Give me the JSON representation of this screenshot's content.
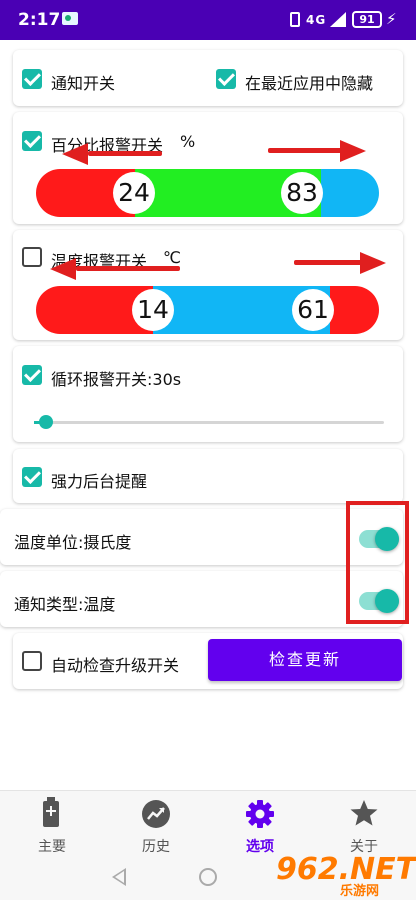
{
  "status_bar": {
    "time": "2:17",
    "network": "4G",
    "battery": "91",
    "bolt": "⚡"
  },
  "notify_card": {
    "notify_switch_label": "通知开关",
    "notify_switch_checked": true,
    "hide_recent_label": "在最近应用中隐藏",
    "hide_recent_checked": true
  },
  "percent_card": {
    "label": "百分比报警开关",
    "unit": "%",
    "checked": true,
    "low_value": "24",
    "high_value": "83",
    "colors": {
      "low": "#ff1a1a",
      "mid": "#22ee22",
      "high": "#11b6f5"
    }
  },
  "temp_card": {
    "label": "温度报警开关",
    "unit": "℃",
    "checked": false,
    "low_value": "14",
    "high_value": "61",
    "colors": {
      "low": "#ff1a1a",
      "mid": "#11b6f5",
      "high": "#ff1a1a"
    }
  },
  "loop_card": {
    "label": "循环报警开关:30s",
    "checked": true,
    "slider_level": 0.03
  },
  "force_card": {
    "label": "强力后台提醒",
    "checked": true
  },
  "temp_unit_row": {
    "label": "温度单位:摄氏度",
    "on": true
  },
  "notify_type_row": {
    "label": "通知类型:温度",
    "on": true
  },
  "update_card": {
    "auto_check_label": "自动检查升级开关",
    "auto_check_checked": false,
    "check_button": "检查更新"
  },
  "bottom_nav": {
    "items": [
      {
        "label": "主要",
        "icon": "battery-icon"
      },
      {
        "label": "历史",
        "icon": "trend-icon"
      },
      {
        "label": "选项",
        "icon": "gear-icon"
      },
      {
        "label": "关于",
        "icon": "star-icon"
      }
    ],
    "active_index": 2
  },
  "watermark": {
    "text": "962.NET",
    "sub": "乐游网"
  },
  "colors": {
    "accent": "#17b9a8",
    "primary": "#6200ee",
    "status_bar": "#4a00b4",
    "annotation": "#e01f1f"
  }
}
